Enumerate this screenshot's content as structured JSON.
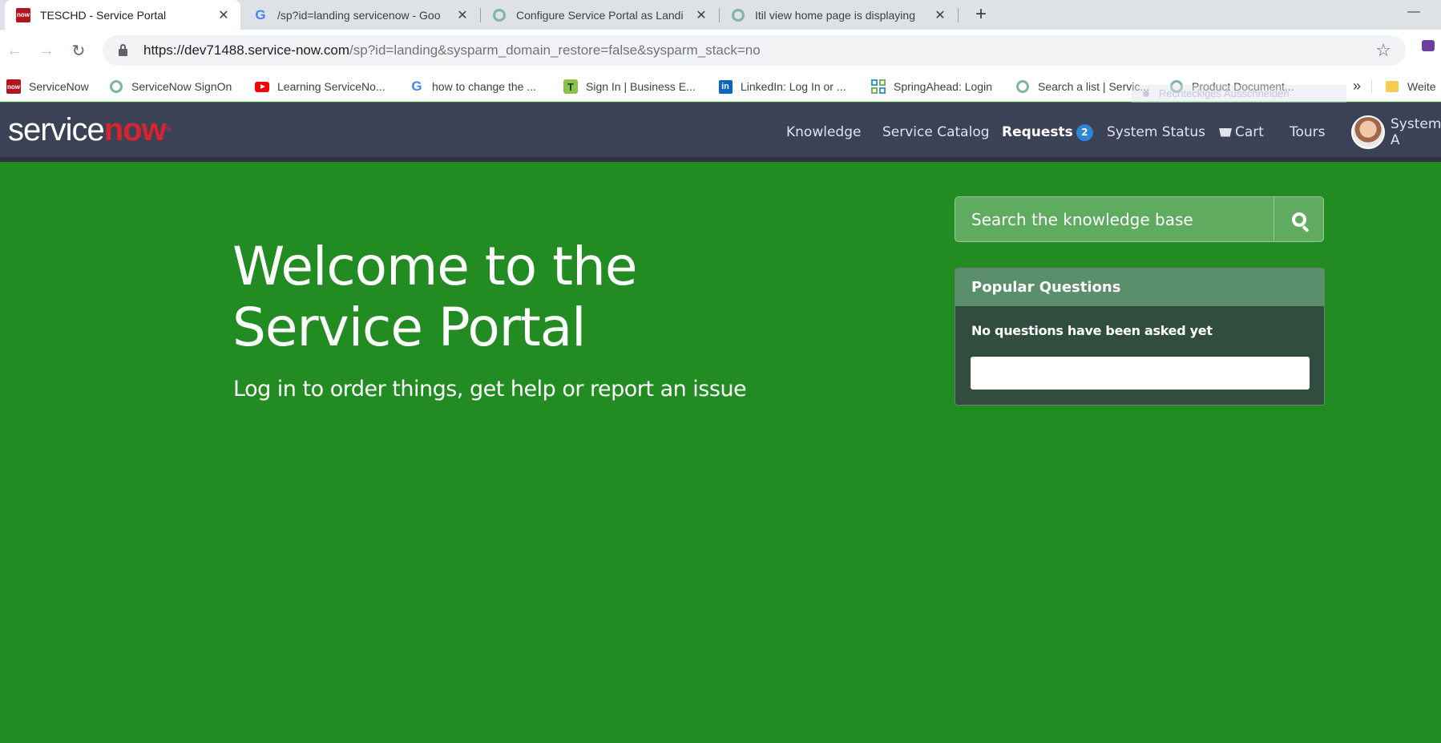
{
  "browser": {
    "tabs": [
      {
        "title": "TESCHD - Service Portal",
        "icon": "servicenow-favicon",
        "active": true
      },
      {
        "title": "/sp?id=landing servicenow - Goo",
        "icon": "google-favicon",
        "active": false
      },
      {
        "title": "Configure Service Portal as Landi",
        "icon": "servicenow-community-favicon",
        "active": false
      },
      {
        "title": "Itil view home page is displaying",
        "icon": "servicenow-community-favicon",
        "active": false
      }
    ],
    "new_tab": "+",
    "minimize": "—",
    "address": {
      "host": "https://dev71488.service-now.com",
      "path": "/sp?id=landing&sysparm_domain_restore=false&sysparm_stack=no"
    },
    "bookmarks": [
      {
        "label": "ServiceNow",
        "icon": "servicenow-favicon"
      },
      {
        "label": "ServiceNow SignOn",
        "icon": "servicenow-community-favicon"
      },
      {
        "label": "Learning ServiceNo...",
        "icon": "youtube-favicon"
      },
      {
        "label": "how to change the ...",
        "icon": "google-favicon"
      },
      {
        "label": "Sign In | Business E...",
        "icon": "t-favicon"
      },
      {
        "label": "LinkedIn: Log In or ...",
        "icon": "linkedin-favicon"
      },
      {
        "label": "SpringAhead: Login",
        "icon": "grid-favicon"
      },
      {
        "label": "Search a list | Servic...",
        "icon": "servicenow-community-favicon"
      },
      {
        "label": "Product Document...",
        "icon": "servicenow-community-favicon"
      }
    ],
    "bookmarks_more": "»",
    "other_bookmarks": "Weite",
    "ghost_tooltip": "Rechteckiges Ausschneiden"
  },
  "portal": {
    "logo": {
      "part1": "service",
      "part2": "now",
      "mark": "®"
    },
    "nav": {
      "knowledge": "Knowledge",
      "catalog": "Service Catalog",
      "requests": "Requests",
      "requests_count": "2",
      "status": "System Status",
      "cart": "Cart",
      "tours": "Tours",
      "user": "System A"
    },
    "hero": {
      "title_line1": "Welcome to the",
      "title_line2": "Service Portal",
      "subtitle": "Log in to order things, get help or report an issue"
    },
    "search": {
      "placeholder": "Search the knowledge base"
    },
    "popular_questions": {
      "heading": "Popular Questions",
      "empty_text": "No questions have been asked yet"
    },
    "colors": {
      "background": "#228b22",
      "header": "#3c4256",
      "brand_red": "#d7252f",
      "badge": "#2f87d4"
    }
  }
}
